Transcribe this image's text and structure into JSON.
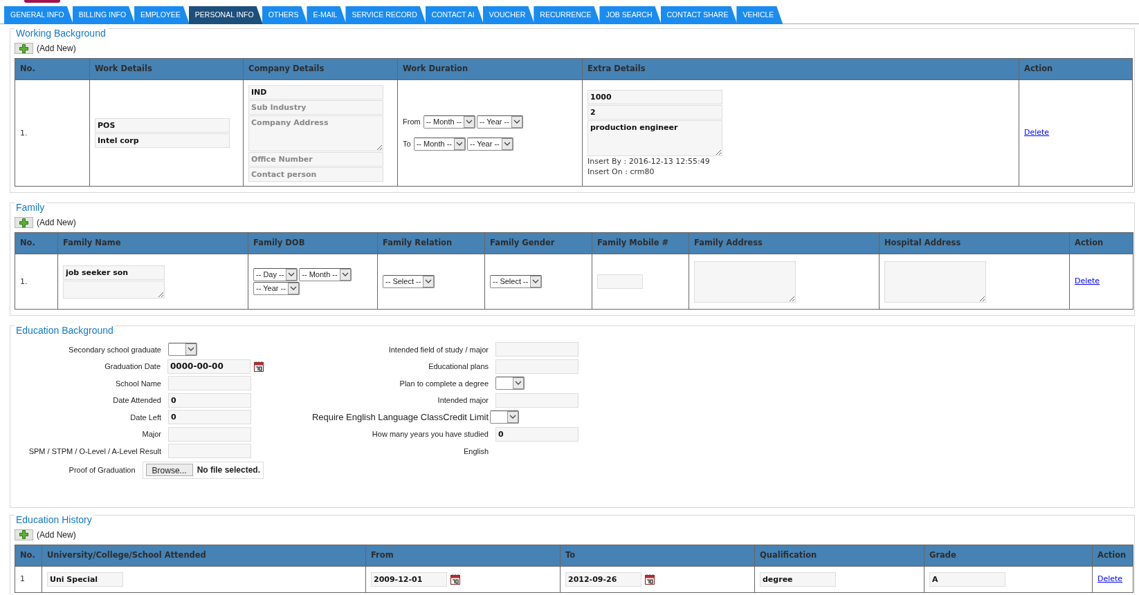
{
  "tabs": [
    {
      "label": "GENERAL INFO",
      "selected": false
    },
    {
      "label": "BILLING INFO",
      "selected": false
    },
    {
      "label": "EMPLOYEE",
      "selected": false
    },
    {
      "label": "PERSONAL INFO",
      "selected": true
    },
    {
      "label": "OTHERS",
      "selected": false
    },
    {
      "label": "E-MAIL",
      "selected": false
    },
    {
      "label": "SERVICE RECORD",
      "selected": false
    },
    {
      "label": "CONTACT AI",
      "selected": false
    },
    {
      "label": "VOUCHER",
      "selected": false
    },
    {
      "label": "RECURRENCE",
      "selected": false
    },
    {
      "label": "JOB SEARCH",
      "selected": false
    },
    {
      "label": "CONTACT SHARE",
      "selected": false
    },
    {
      "label": "VEHICLE",
      "selected": false
    }
  ],
  "sections": [
    {
      "kind": "table",
      "title": "Working Background",
      "add_new": "(Add New)",
      "columns": [
        "No.",
        "Work Details",
        "Company Details",
        "Work Duration",
        "Extra Details",
        "Action"
      ],
      "rows": [
        {
          "cells": [
            [
              {
                "kind": "text",
                "text": "1."
              }
            ],
            [
              {
                "kind": "input",
                "value": "POS"
              },
              {
                "kind": "input",
                "value": "Intel corp"
              }
            ],
            [
              {
                "kind": "input",
                "value": "IND"
              },
              {
                "kind": "input",
                "placeholder": "Sub Industry"
              },
              {
                "kind": "textarea",
                "placeholder": "Company Address"
              },
              {
                "kind": "input",
                "placeholder": "Office Number"
              },
              {
                "kind": "input",
                "placeholder": "Contact person"
              }
            ],
            [
              {
                "kind": "selects",
                "label": "From",
                "options": [
                  "-- Month --",
                  "-- Year --"
                ]
              },
              {
                "kind": "selects",
                "label": "To",
                "options": [
                  "-- Month --",
                  "-- Year --"
                ]
              }
            ],
            [
              {
                "kind": "input",
                "value": "1000"
              },
              {
                "kind": "input",
                "value": "2"
              },
              {
                "kind": "textarea",
                "value": "production engineer"
              },
              {
                "kind": "note",
                "text": "Insert By : 2016-12-13 12:55:49"
              },
              {
                "kind": "note",
                "text": "Insert On : crm80"
              }
            ],
            [
              {
                "kind": "link",
                "text": "Delete"
              }
            ]
          ]
        }
      ]
    },
    {
      "kind": "table",
      "title": "Family",
      "add_new": "(Add New)",
      "columns": [
        "No.",
        "Family Name",
        "Family DOB",
        "Family Relation",
        "Family Gender",
        "Family Mobile #",
        "Family Address",
        "Hospital Address",
        "Action"
      ],
      "rows": [
        {
          "cells": [
            [
              {
                "kind": "text",
                "text": "1."
              }
            ],
            [
              {
                "kind": "input",
                "value": "job seeker son"
              },
              {
                "kind": "textarea"
              }
            ],
            [
              {
                "kind": "selects",
                "options": [
                  "-- Day --",
                  "-- Month --"
                ]
              },
              {
                "kind": "selects",
                "options": [
                  "-- Year --"
                ]
              }
            ],
            [
              {
                "kind": "selects",
                "options": [
                  "-- Select --"
                ]
              }
            ],
            [
              {
                "kind": "selects",
                "options": [
                  "-- Select --"
                ]
              }
            ],
            [
              {
                "kind": "input"
              }
            ],
            [
              {
                "kind": "textarea"
              }
            ],
            [
              {
                "kind": "textarea"
              }
            ],
            [
              {
                "kind": "link",
                "text": "Delete"
              }
            ]
          ]
        }
      ]
    },
    {
      "kind": "form",
      "title": "Education Background",
      "left": [
        {
          "label": "Secondary school graduate",
          "kind": "select"
        },
        {
          "label": "Graduation Date",
          "kind": "date",
          "value": "0000-00-00"
        },
        {
          "label": "School Name",
          "kind": "input"
        },
        {
          "label": "Date Attended",
          "kind": "input",
          "value": "0"
        },
        {
          "label": "Date Left",
          "kind": "input",
          "value": "0"
        },
        {
          "label": "Major",
          "kind": "input"
        },
        {
          "label": "SPM / STPM / O-Level / A-Level Result",
          "kind": "input"
        },
        {
          "label": "Proof of Graduation",
          "kind": "file",
          "button": "Browse...",
          "value": "No file selected."
        }
      ],
      "right": [
        {
          "label": "Intended field of study / major",
          "kind": "input"
        },
        {
          "label": "Educational plans",
          "kind": "input"
        },
        {
          "label": "Plan to complete a degree",
          "kind": "select"
        },
        {
          "label": "Intended major",
          "kind": "input"
        },
        {
          "label": "Require English Language ClassCredit Limit",
          "kind": "select",
          "large": true
        },
        {
          "label": "How many years you have studied",
          "kind": "input",
          "value": "0"
        },
        {
          "label": "English",
          "kind": "none"
        }
      ]
    },
    {
      "kind": "table",
      "title": "Education History",
      "add_new": "(Add New)",
      "columns": [
        "No.",
        "University/College/School Attended",
        "From",
        "To",
        "Qualification",
        "Grade",
        "Action"
      ],
      "rows": [
        {
          "cells": [
            [
              {
                "kind": "text",
                "text": "1"
              }
            ],
            [
              {
                "kind": "input",
                "value": "Uni Special"
              }
            ],
            [
              {
                "kind": "date",
                "value": "2009-12-01"
              }
            ],
            [
              {
                "kind": "date",
                "value": "2012-09-26"
              }
            ],
            [
              {
                "kind": "input",
                "value": "degree"
              }
            ],
            [
              {
                "kind": "input",
                "value": "A"
              }
            ],
            [
              {
                "kind": "link",
                "text": "Delete"
              }
            ]
          ]
        }
      ]
    }
  ]
}
